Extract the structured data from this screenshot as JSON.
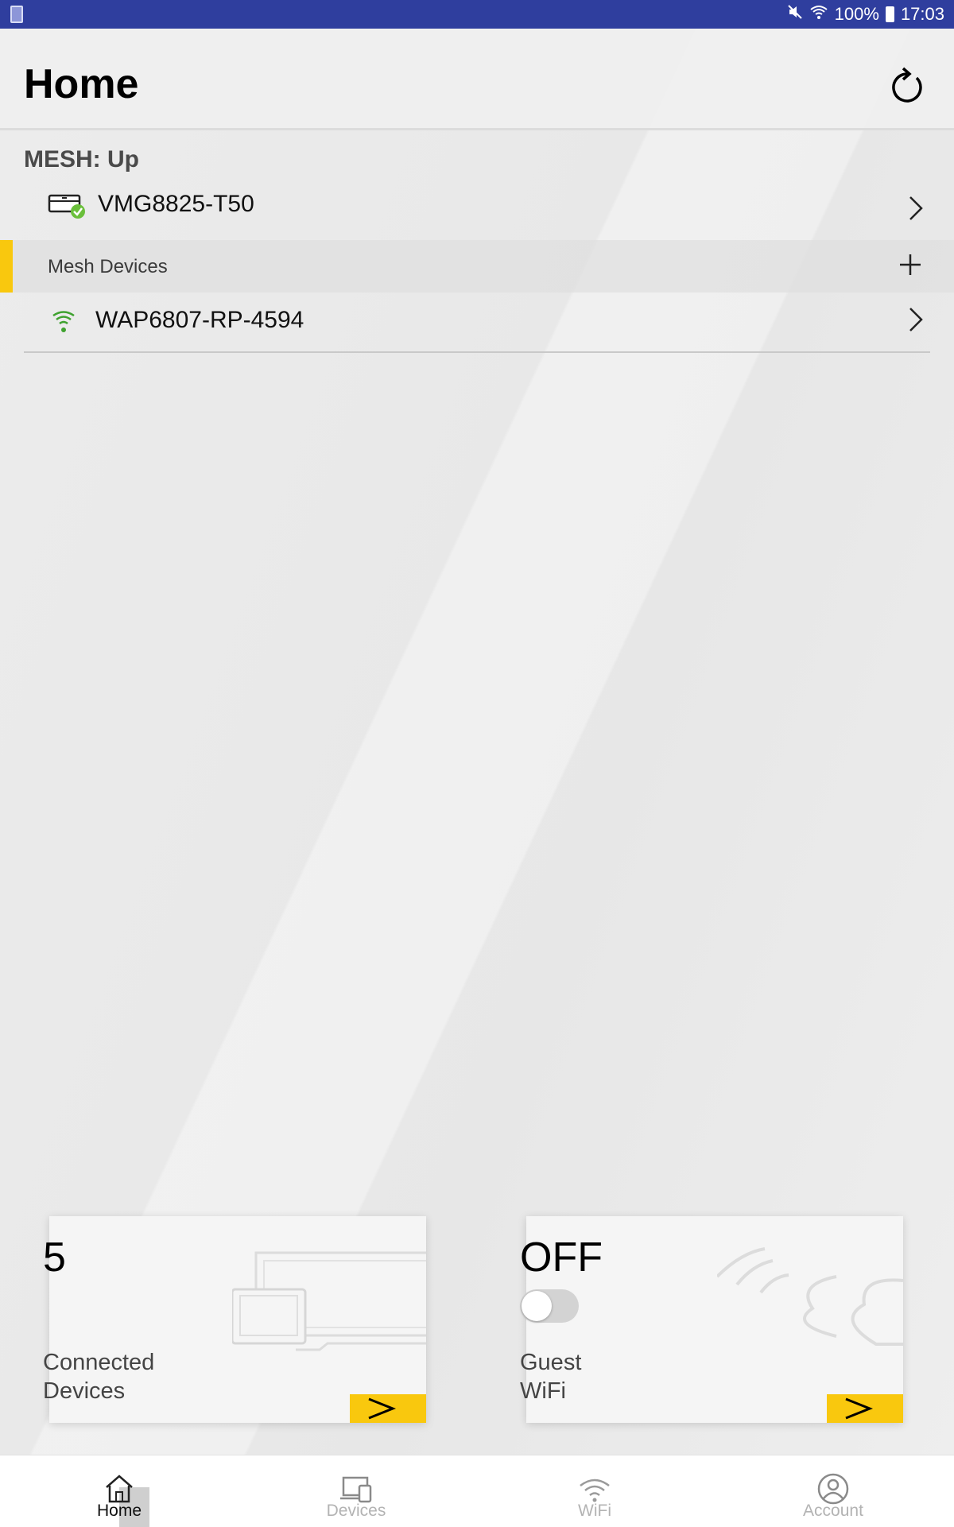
{
  "status_bar": {
    "battery_percent": "100%",
    "time": "17:03",
    "icons": [
      "notification-icon",
      "mute-icon",
      "wifi-icon",
      "battery-icon"
    ],
    "background_color": "#2f3e9e"
  },
  "header": {
    "title": "Home",
    "refresh_icon": "refresh-icon"
  },
  "mesh": {
    "status": "MESH: Up",
    "gateway": {
      "name": "VMG8825-T50",
      "icon": "router-icon",
      "status_color": "#6abf3b"
    },
    "section_label": "Mesh Devices",
    "devices": [
      {
        "name": "WAP6807-RP-4594",
        "icon": "wifi-signal-icon",
        "signal_color": "#3fa22f"
      }
    ]
  },
  "cards": {
    "connected": {
      "count": "5",
      "label_line1": "Connected",
      "label_line2": "Devices"
    },
    "guest_wifi": {
      "state": "OFF",
      "toggle_on": false,
      "label_line1": "Guest",
      "label_line2": "WiFi"
    },
    "accent_color": "#f9c80e"
  },
  "nav": {
    "items": [
      {
        "label": "Home",
        "icon": "home-icon",
        "active": true
      },
      {
        "label": "Devices",
        "icon": "devices-icon",
        "active": false
      },
      {
        "label": "WiFi",
        "icon": "wifi-icon",
        "active": false
      },
      {
        "label": "Account",
        "icon": "account-icon",
        "active": false
      }
    ]
  }
}
